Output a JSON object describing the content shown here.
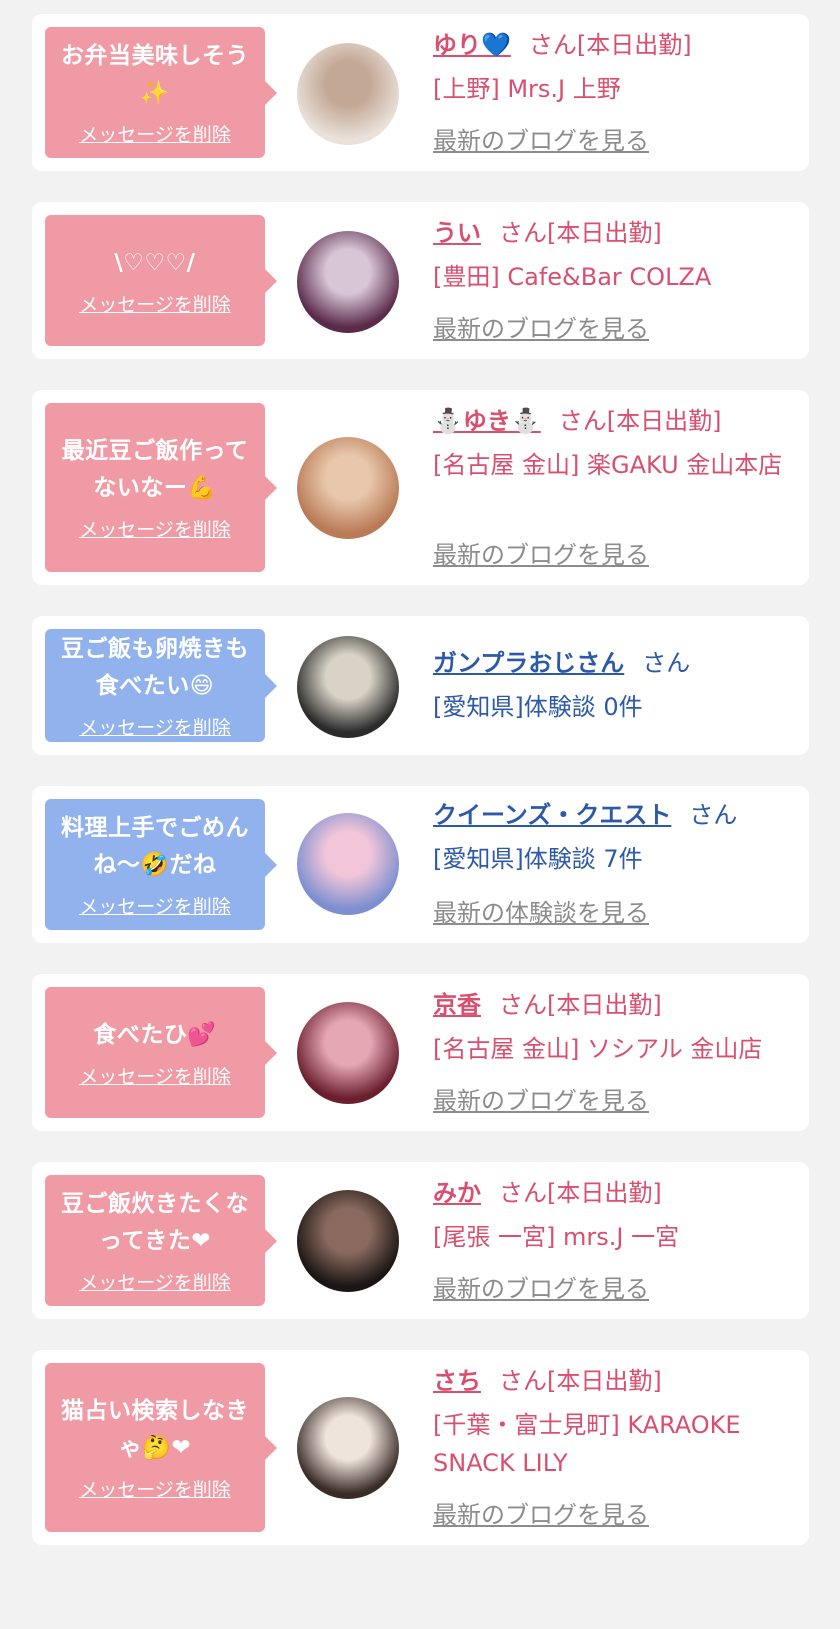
{
  "delete_label": "メッセージを削除",
  "messages": [
    {
      "kind": "cast",
      "message_lines": [
        "お弁当美味しそう",
        "✨"
      ],
      "name": "ゆり💙",
      "suffix": "さん[本日出勤]",
      "shop": "[上野] Mrs.J 上野",
      "link": "最新のブログを見る",
      "avatar_colors": [
        "#e9e1da",
        "#c4a896"
      ]
    },
    {
      "kind": "cast",
      "message_lines": [
        "\\♡♡♡/"
      ],
      "name": "うい",
      "suffix": "さん[本日出勤]",
      "shop": "[豊田] Cafe&Bar COLZA",
      "link": "最新のブログを見る",
      "avatar_colors": [
        "#5a2a4a",
        "#d7c6d6"
      ]
    },
    {
      "kind": "cast",
      "message_lines": [
        "最近豆ご飯作って",
        "ないなー💪"
      ],
      "name": "⛄ゆき⛄",
      "suffix": "さん[本日出勤]",
      "shop": "[名古屋 金山] 楽GAKU 金山本店",
      "link": "最新のブログを見る",
      "avatar_colors": [
        "#b97a55",
        "#e8c7ac"
      ]
    },
    {
      "kind": "user",
      "message_lines": [
        "豆ご飯も卵焼きも",
        "食べたい😄"
      ],
      "name": "ガンプラおじさん",
      "suffix": "さん",
      "shop": "[愛知県]体験談 0件",
      "link": "",
      "avatar_colors": [
        "#2b2b2b",
        "#d8d3c6"
      ]
    },
    {
      "kind": "user",
      "message_lines": [
        "料理上手でごめん",
        "ね〜🤣だね"
      ],
      "name": "クイーンズ・クエスト",
      "suffix": "さん",
      "shop": "[愛知県]体験談 7件",
      "link": "最新の体験談を見る",
      "avatar_colors": [
        "#7d8fd0",
        "#f2c6d8"
      ]
    },
    {
      "kind": "cast",
      "message_lines": [
        "食べたひ💕"
      ],
      "name": "京香",
      "suffix": "さん[本日出勤]",
      "shop": "[名古屋 金山] ソシアル 金山店",
      "link": "最新のブログを見る",
      "avatar_colors": [
        "#6a1f2e",
        "#e6a7b5"
      ]
    },
    {
      "kind": "cast",
      "message_lines": [
        "豆ご飯炊きたくな",
        "ってきた❤"
      ],
      "name": "みか",
      "suffix": "さん[本日出勤]",
      "shop": "[尾張 一宮] mrs.J 一宮",
      "link": "最新のブログを見る",
      "avatar_colors": [
        "#1b1614",
        "#8a6a5e"
      ]
    },
    {
      "kind": "cast",
      "message_lines": [
        "猫占い検索しなき",
        "ゃ🤔❤"
      ],
      "name": "さち",
      "suffix": "さん[本日出勤]",
      "shop": "[千葉・富士見町] KARAOKE SNACK LILY",
      "link": "最新のブログを見る",
      "avatar_colors": [
        "#3a2d28",
        "#efe4dc"
      ]
    }
  ]
}
